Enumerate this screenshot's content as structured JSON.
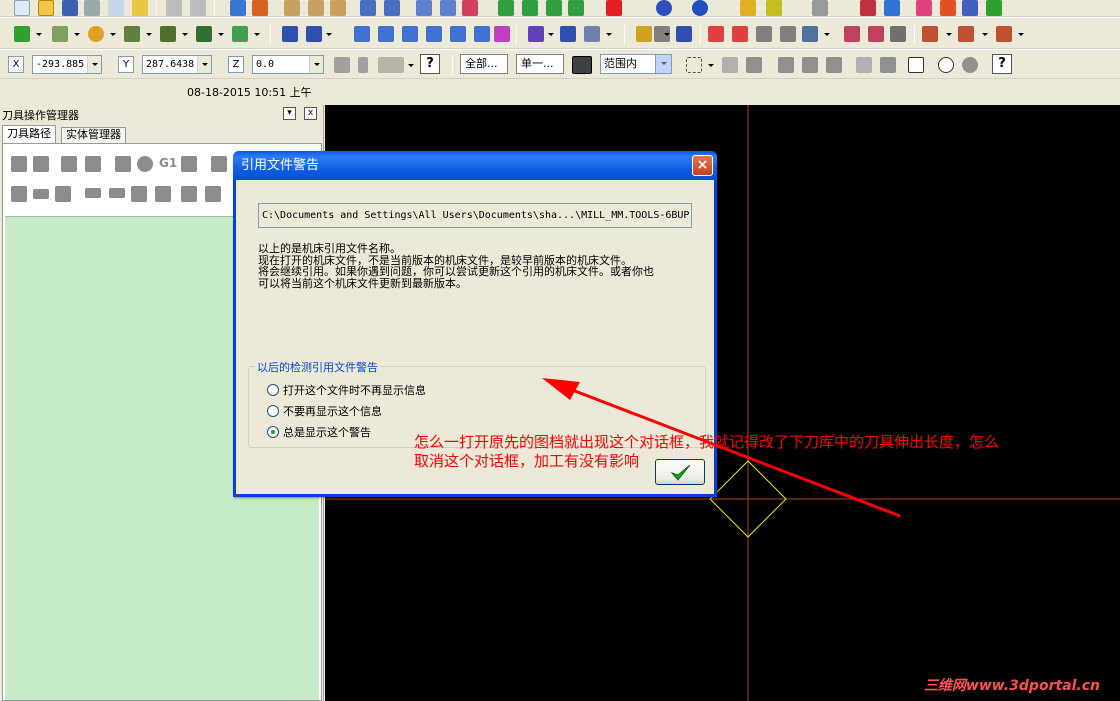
{
  "toolbar": {
    "x_label": "X",
    "x_value": "-293.885",
    "y_label": "Y",
    "y_value": "287.6438",
    "z_label": "Z",
    "z_value": "0.0",
    "all_button": "全部...",
    "single_button": "单一...",
    "range_select": "范围内",
    "help": "?"
  },
  "status": {
    "datetime": "08-18-2015  10:51  上午"
  },
  "panel": {
    "title": "刀具操作管理器",
    "pin_glyph": "▾",
    "close_glyph": "x",
    "tabs": [
      "刀具路径",
      "实体管理器"
    ],
    "g1_label": "G1"
  },
  "dialog": {
    "title": "引用文件警告",
    "close_glyph": "×",
    "path": "C:\\Documents and Settings\\All Users\\Documents\\sha...\\MILL_MM.TOOLS-6BUP",
    "message_lines": [
      "以上的是机床引用文件名称。",
      "现在打开的机床文件，不是当前版本的机床文件，是较早前版本的机床文件。",
      "将会继续引用。如果你遇到问题，你可以尝试更新这个引用的机床文件。或者你也",
      "可以将当前这个机床文件更新到最新版本。"
    ],
    "group_label": "以后的检测引用文件警告",
    "options": [
      {
        "label": "打开这个文件时不再显示信息",
        "selected": false
      },
      {
        "label": "不要再显示这个信息",
        "selected": false
      },
      {
        "label": "总是显示这个警告",
        "selected": true
      }
    ]
  },
  "annotation": {
    "lines": [
      "怎么一打开原先的图档就出现这个对话框，我就记得改了下刀库中的刀具伸出长度，怎么",
      "取消这个对话框，加工有没有影响"
    ],
    "color": "#ff0000"
  },
  "watermark": "三维网www.3dportal.cn",
  "colors": {
    "graphics_bg": "#000000",
    "tree_bg": "#c6ebc6",
    "axis": "#b04020",
    "wcs": "#e8e800",
    "titlebar": "#0a5ae8"
  }
}
